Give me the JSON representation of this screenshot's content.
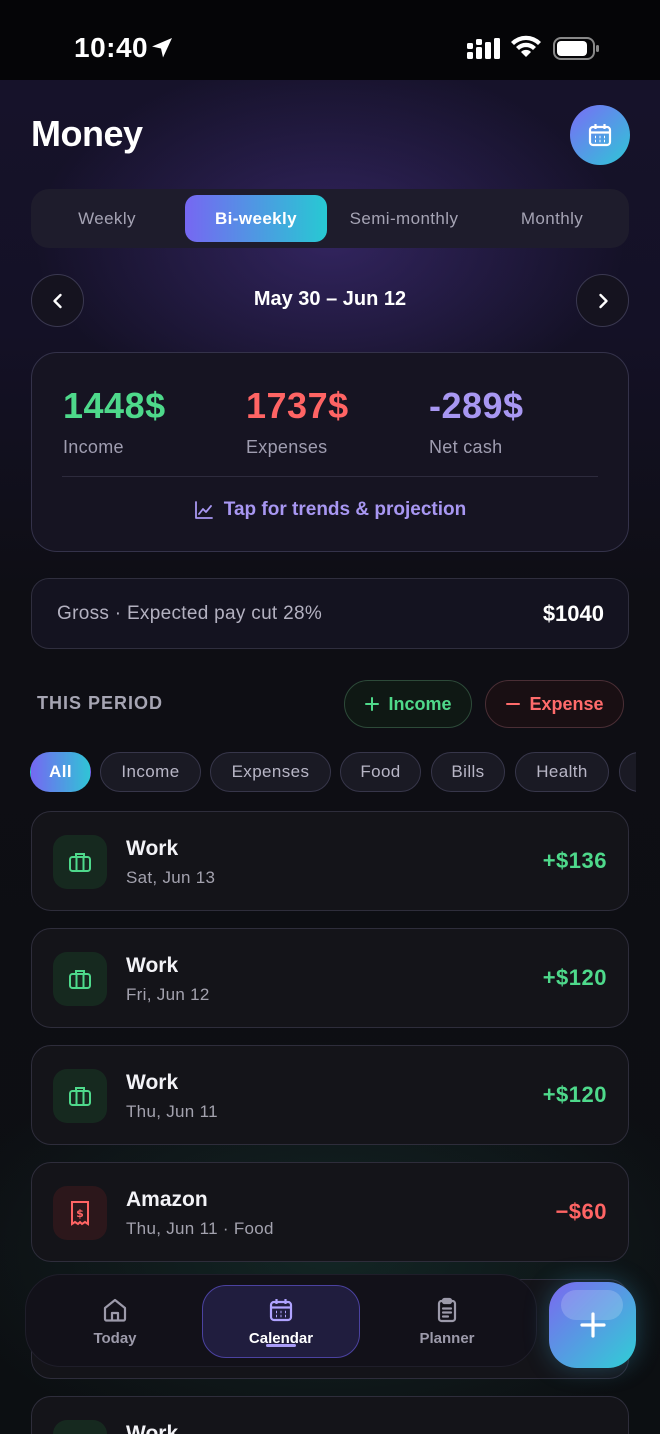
{
  "status": {
    "time": "10:40"
  },
  "header": {
    "title": "Money"
  },
  "segments": [
    "Weekly",
    "Bi-weekly",
    "Semi-monthly",
    "Monthly"
  ],
  "selected_segment": "Bi-weekly",
  "period_nav": {
    "range": "May 30 – Jun 12"
  },
  "summary": {
    "income": {
      "value": "1448$",
      "label": "Income"
    },
    "expenses": {
      "value": "1737$",
      "label": "Expenses"
    },
    "net": {
      "value": "-289$",
      "label": "Net cash"
    },
    "trends_label": "Tap for trends & projection"
  },
  "gross": {
    "label": "Gross · Expected pay cut 28%",
    "value": "$1040"
  },
  "section": {
    "title": "THIS PERIOD",
    "add_income": "Income",
    "add_expense": "Expense"
  },
  "filters": [
    "All",
    "Income",
    "Expenses",
    "Food",
    "Bills",
    "Health"
  ],
  "transactions": [
    {
      "name": "Work",
      "date": "Sat, Jun 13",
      "amount": "+$136",
      "icon": "briefcase-icon"
    },
    {
      "name": "Work",
      "date": "Fri, Jun 12",
      "amount": "+$120",
      "icon": "briefcase-icon"
    },
    {
      "name": "Work",
      "date": "Thu, Jun 11",
      "amount": "+$120",
      "icon": "briefcase-icon"
    },
    {
      "name": "Amazon",
      "date": "Thu, Jun 11 · Food",
      "amount": "−$60",
      "icon": "receipt-icon"
    },
    {
      "name": "Work",
      "date": "",
      "amount": "",
      "icon": "briefcase-icon"
    }
  ],
  "tabbar": {
    "today": "Today",
    "calendar": "Calendar",
    "planner": "Planner"
  },
  "colors": {
    "income": "#4ed98b",
    "expense": "#ff6464",
    "net": "#a897f2",
    "accent_start": "#7667f2",
    "accent_end": "#27c9d3"
  }
}
